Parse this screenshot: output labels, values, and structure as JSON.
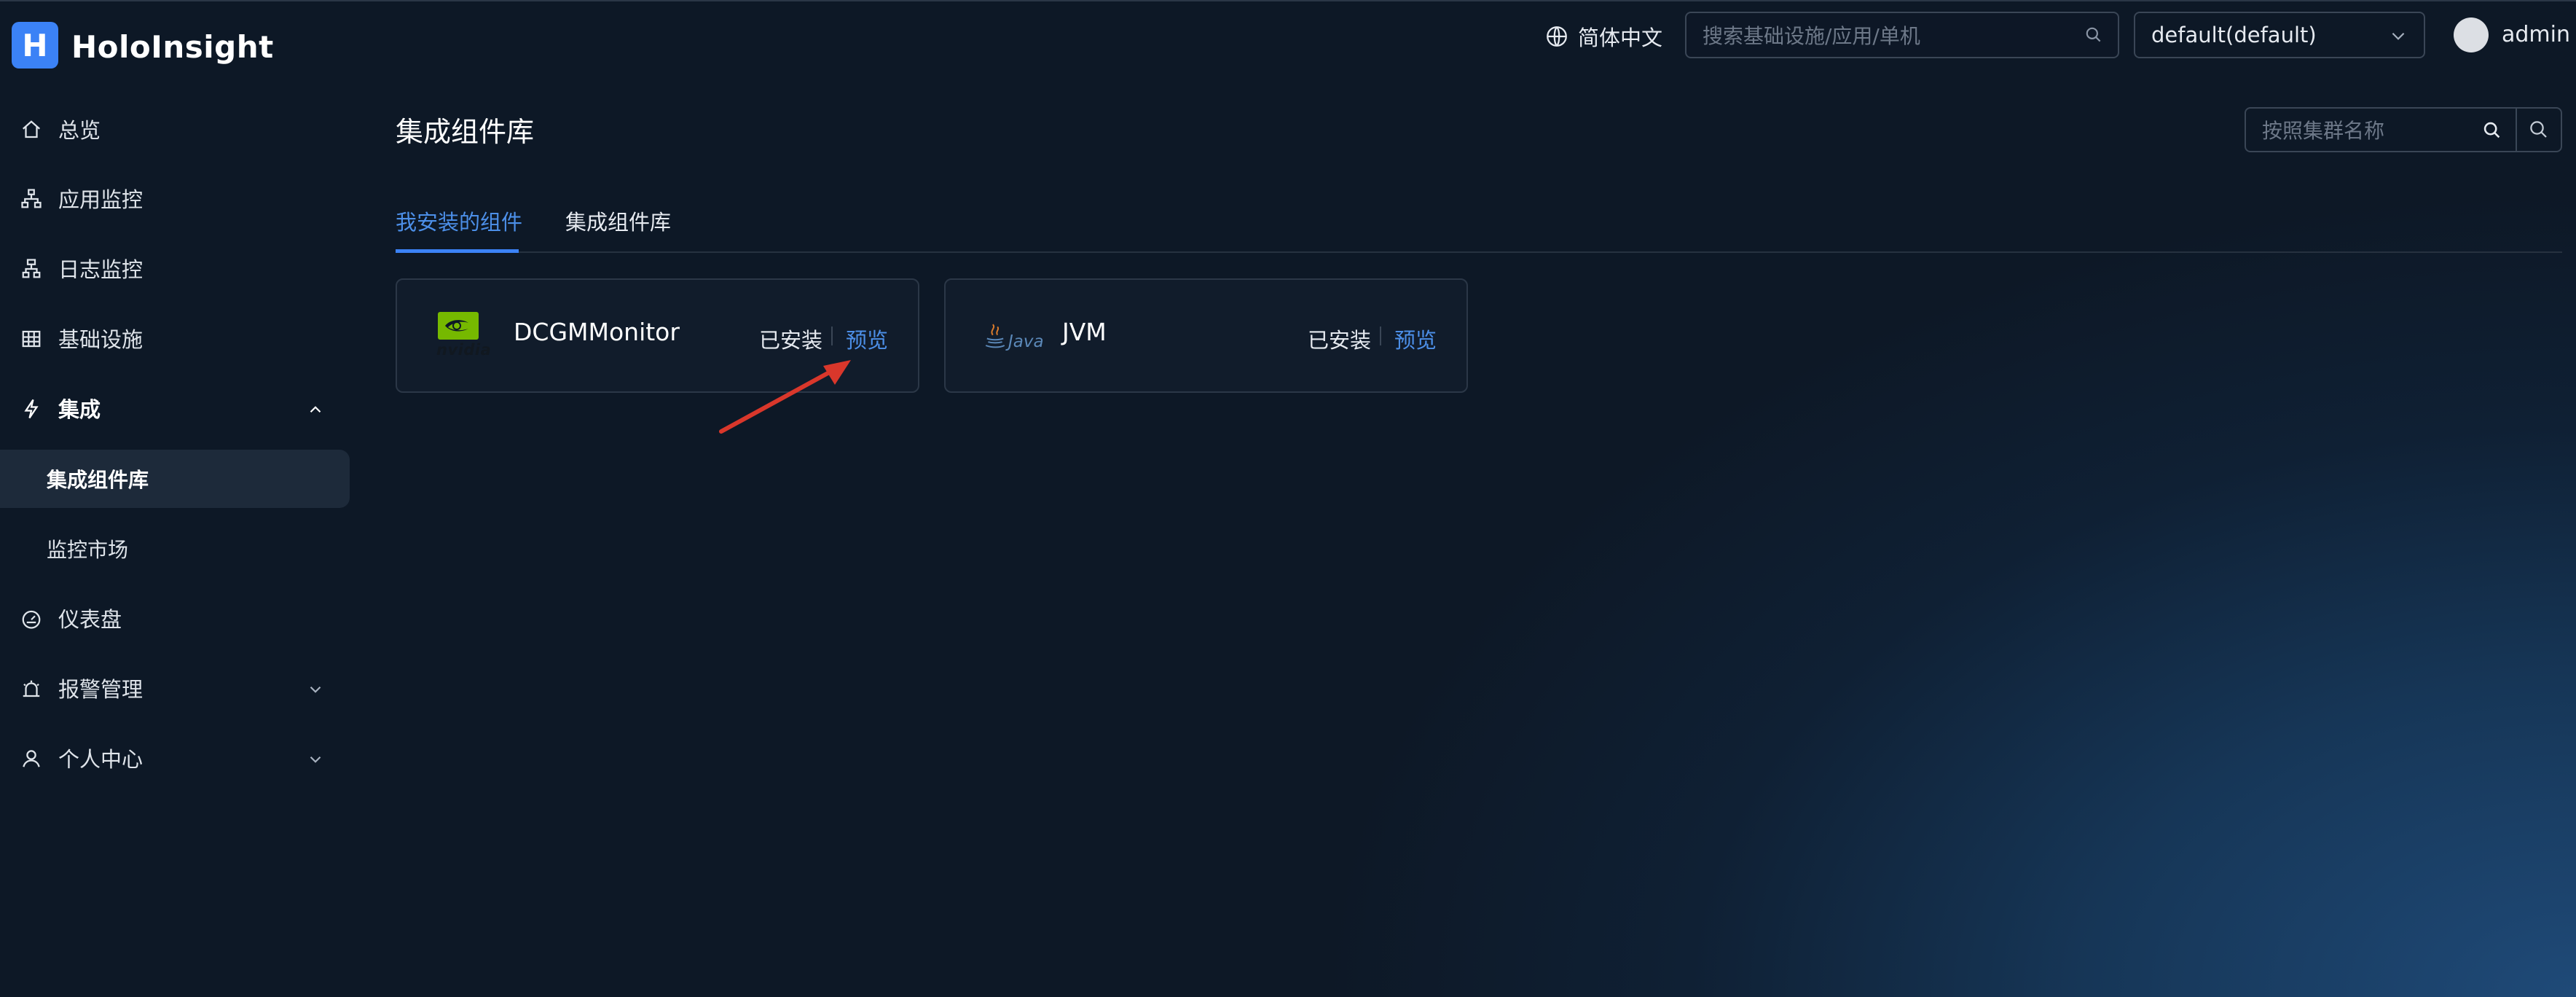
{
  "app": {
    "logo_letter": "H",
    "name": "HoloInsight"
  },
  "header": {
    "language": "简体中文",
    "search_placeholder": "搜索基础设施/应用/单机",
    "tenant_select": "default(default)",
    "user": "admin"
  },
  "sidebar": {
    "items": [
      {
        "label": "总览",
        "icon": "home-icon"
      },
      {
        "label": "应用监控",
        "icon": "sitemap-icon"
      },
      {
        "label": "日志监控",
        "icon": "log-icon"
      },
      {
        "label": "基础设施",
        "icon": "table-icon"
      },
      {
        "label": "集成",
        "icon": "lightning-icon",
        "expanded": true
      },
      {
        "label": "集成组件库",
        "sub": true,
        "active": true
      },
      {
        "label": "监控市场",
        "sub": true
      },
      {
        "label": "仪表盘",
        "icon": "dashboard-icon"
      },
      {
        "label": "报警管理",
        "icon": "alarm-icon",
        "expandable": true
      },
      {
        "label": "个人中心",
        "icon": "user-icon",
        "expandable": true
      }
    ]
  },
  "main": {
    "title": "集成组件库",
    "cluster_search_placeholder": "按照集群名称",
    "tabs": [
      {
        "label": "我安装的组件",
        "active": true
      },
      {
        "label": "集成组件库",
        "active": false
      }
    ],
    "cards": [
      {
        "name": "DCGMMonitor",
        "logo_text": "nvidia",
        "status": "已安装",
        "action": "预览"
      },
      {
        "name": "JVM",
        "logo_text": "Java",
        "status": "已安装",
        "action": "预览"
      }
    ]
  },
  "colors": {
    "background": "#0d1826",
    "accent": "#3b82f6",
    "link": "#4c8fe8",
    "annotation_arrow": "#d9372b",
    "nvidia_green": "#76b900"
  }
}
